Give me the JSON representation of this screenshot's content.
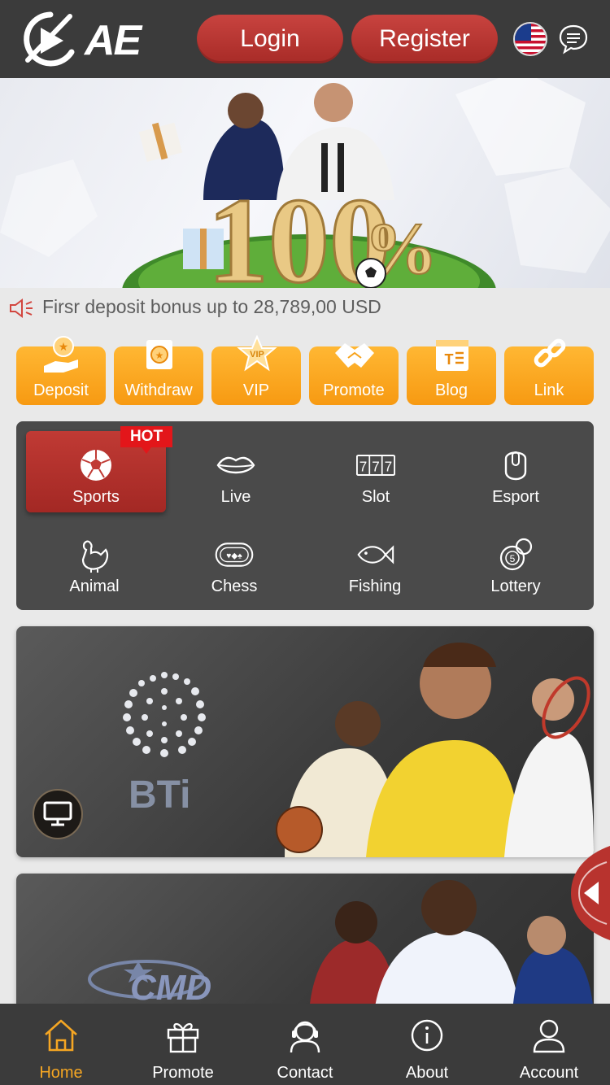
{
  "header": {
    "logo_text": "AE",
    "login_label": "Login",
    "register_label": "Register",
    "flag_icon": "us-flag-icon",
    "chat_icon": "chat-icon"
  },
  "banner": {
    "headline": "100",
    "percent": "%"
  },
  "marquee": {
    "text": "Firsr deposit bonus up to 28,789,00 USD"
  },
  "quick_menu": [
    {
      "label": "Deposit",
      "icon": "deposit-icon"
    },
    {
      "label": "Withdraw",
      "icon": "withdraw-icon"
    },
    {
      "label": "VIP",
      "icon": "vip-icon"
    },
    {
      "label": "Promote",
      "icon": "handshake-icon"
    },
    {
      "label": "Blog",
      "icon": "blog-icon"
    },
    {
      "label": "Link",
      "icon": "link-icon"
    }
  ],
  "categories": [
    {
      "label": "Sports",
      "icon": "soccer-ball-icon",
      "active": true
    },
    {
      "label": "Live",
      "icon": "lips-icon"
    },
    {
      "label": "Slot",
      "icon": "slot-777-icon"
    },
    {
      "label": "Esport",
      "icon": "mouse-icon"
    },
    {
      "label": "Animal",
      "icon": "rooster-icon"
    },
    {
      "label": "Chess",
      "icon": "cards-icon"
    },
    {
      "label": "Fishing",
      "icon": "fish-icon"
    },
    {
      "label": "Lottery",
      "icon": "lottery-ball-icon"
    }
  ],
  "hot_badge": "HOT",
  "providers": [
    {
      "name": "BTi"
    },
    {
      "name": "CMD"
    }
  ],
  "bottom_nav": [
    {
      "label": "Home",
      "icon": "home-icon",
      "active": true
    },
    {
      "label": "Promote",
      "icon": "gift-icon"
    },
    {
      "label": "Contact",
      "icon": "support-icon"
    },
    {
      "label": "About",
      "icon": "info-icon"
    },
    {
      "label": "Account",
      "icon": "user-icon"
    }
  ],
  "colors": {
    "header_bg": "#3b3b3b",
    "accent_red": "#b8332e",
    "accent_orange": "#f7a21a",
    "active_nav": "#f5a623"
  }
}
